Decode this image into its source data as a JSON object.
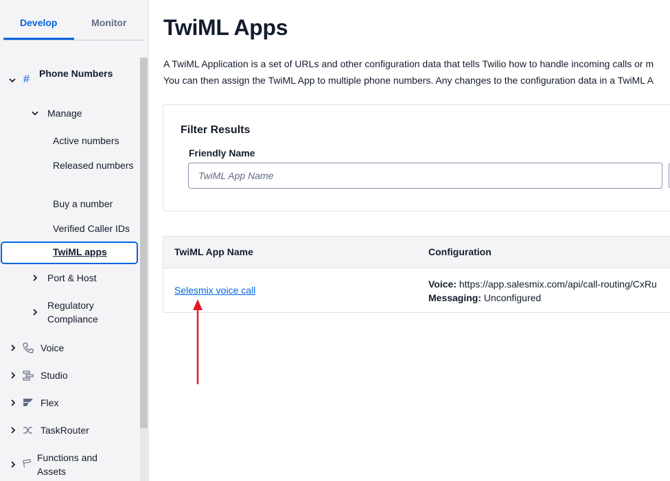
{
  "sidebar": {
    "tabs": [
      {
        "label": "Develop",
        "active": true
      },
      {
        "label": "Monitor",
        "active": false
      }
    ],
    "phone_numbers": "Phone Numbers",
    "manage": "Manage",
    "manage_items": [
      "Active numbers",
      "Released numbers",
      "Buy a number",
      "Verified Caller IDs"
    ],
    "selected_item": "TwiML apps",
    "port_host": "Port & Host",
    "regulatory": "Regulatory Compliance",
    "products": [
      {
        "label": "Voice",
        "icon": "phone-icon"
      },
      {
        "label": "Studio",
        "icon": "studio-icon"
      },
      {
        "label": "Flex",
        "icon": "flex-icon"
      },
      {
        "label": "TaskRouter",
        "icon": "taskrouter-icon"
      },
      {
        "label": "Functions and Assets",
        "icon": "functions-icon"
      }
    ]
  },
  "main": {
    "title": "TwiML Apps",
    "description_line1": "A TwiML Application is a set of URLs and other configuration data that tells Twilio how to handle incoming calls or m",
    "description_line2": "You can then assign the TwiML App to multiple phone numbers. Any changes to the configuration data in a TwiML A",
    "filter": {
      "title": "Filter Results",
      "friendly_name_label": "Friendly Name",
      "placeholder": "TwiML App Name"
    },
    "table": {
      "headers": [
        "TwiML App Name",
        "Configuration"
      ],
      "rows": [
        {
          "name": "Selesmix voice call",
          "voice_label": "Voice:",
          "voice_value": "https://app.salesmix.com/api/call-routing/CxRu",
          "messaging_label": "Messaging:",
          "messaging_value": "Unconfigured"
        }
      ]
    },
    "annotation_color": "#e31c23"
  }
}
